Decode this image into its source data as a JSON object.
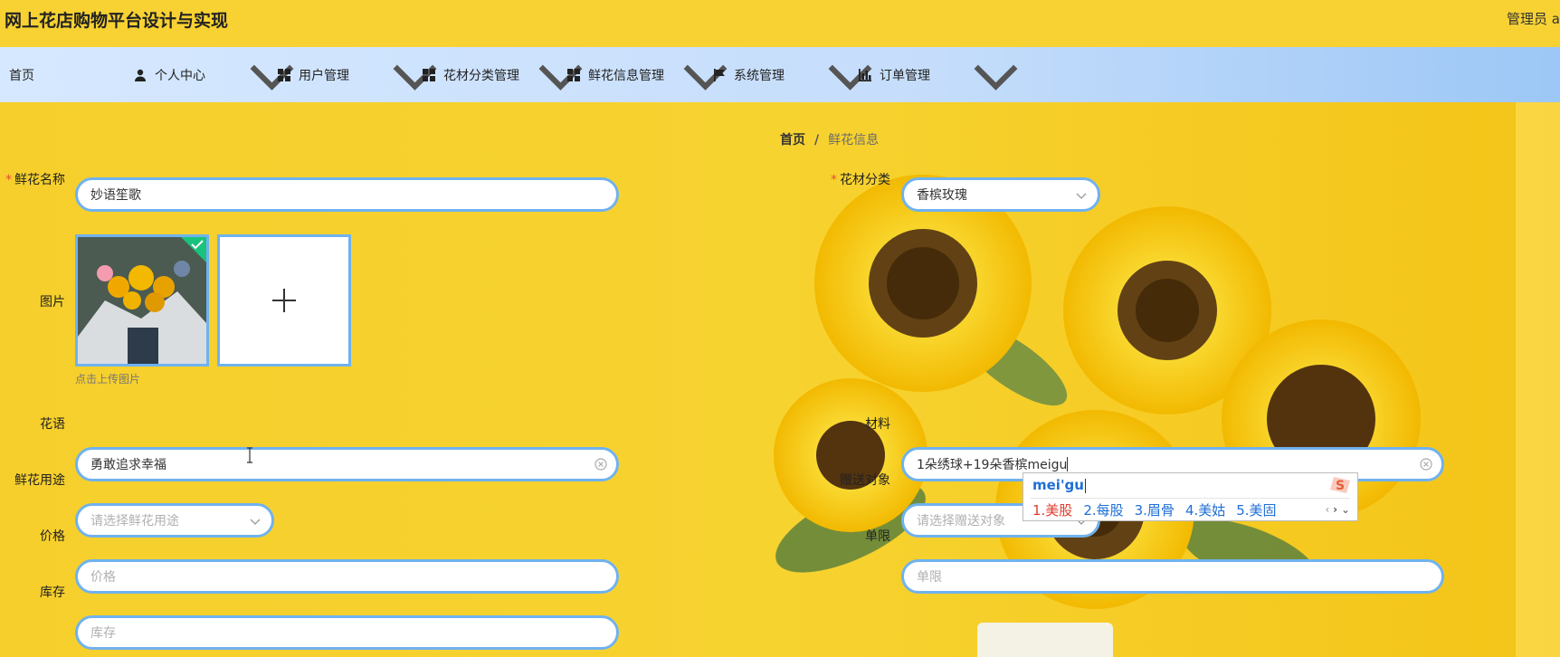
{
  "app": {
    "title": "网上花店购物平台设计与实现",
    "admin_label": "管理员 a"
  },
  "nav": {
    "items": [
      {
        "label": "首页",
        "icon": "none"
      },
      {
        "label": "个人中心",
        "icon": "user-icon"
      },
      {
        "label": "用户管理",
        "icon": "grid-icon"
      },
      {
        "label": "花材分类管理",
        "icon": "grid-icon"
      },
      {
        "label": "鲜花信息管理",
        "icon": "grid-icon"
      },
      {
        "label": "系统管理",
        "icon": "flag-icon"
      },
      {
        "label": "订单管理",
        "icon": "chart-icon"
      }
    ]
  },
  "breadcrumb": {
    "home": "首页",
    "separator": "/",
    "current": "鲜花信息"
  },
  "form": {
    "name": {
      "label": "鲜花名称",
      "value": "妙语笙歌"
    },
    "category": {
      "label": "花材分类",
      "value": "香槟玫瑰"
    },
    "image": {
      "label": "图片",
      "hint": "点击上传图片"
    },
    "flower_language": {
      "label": "花语",
      "value": "勇敢追求幸福"
    },
    "material": {
      "label": "材料",
      "value": "1朵绣球+19朵香槟meigu"
    },
    "usage": {
      "label": "鲜花用途",
      "placeholder": "请选择鲜花用途"
    },
    "gift_target": {
      "label": "赠送对象",
      "placeholder": "请选择赠送对象"
    },
    "price": {
      "label": "价格",
      "placeholder": "价格"
    },
    "limit": {
      "label": "单限",
      "placeholder": "单限"
    },
    "stock": {
      "label": "库存",
      "placeholder": "库存"
    }
  },
  "ime": {
    "pinyin": "mei'gu",
    "candidates": [
      "1.美股",
      "2.每股",
      "3.眉骨",
      "4.美姑",
      "5.美固"
    ]
  },
  "colors": {
    "accent": "#6fb2ef",
    "header": "#f8d233",
    "required": "#e74c3c"
  }
}
